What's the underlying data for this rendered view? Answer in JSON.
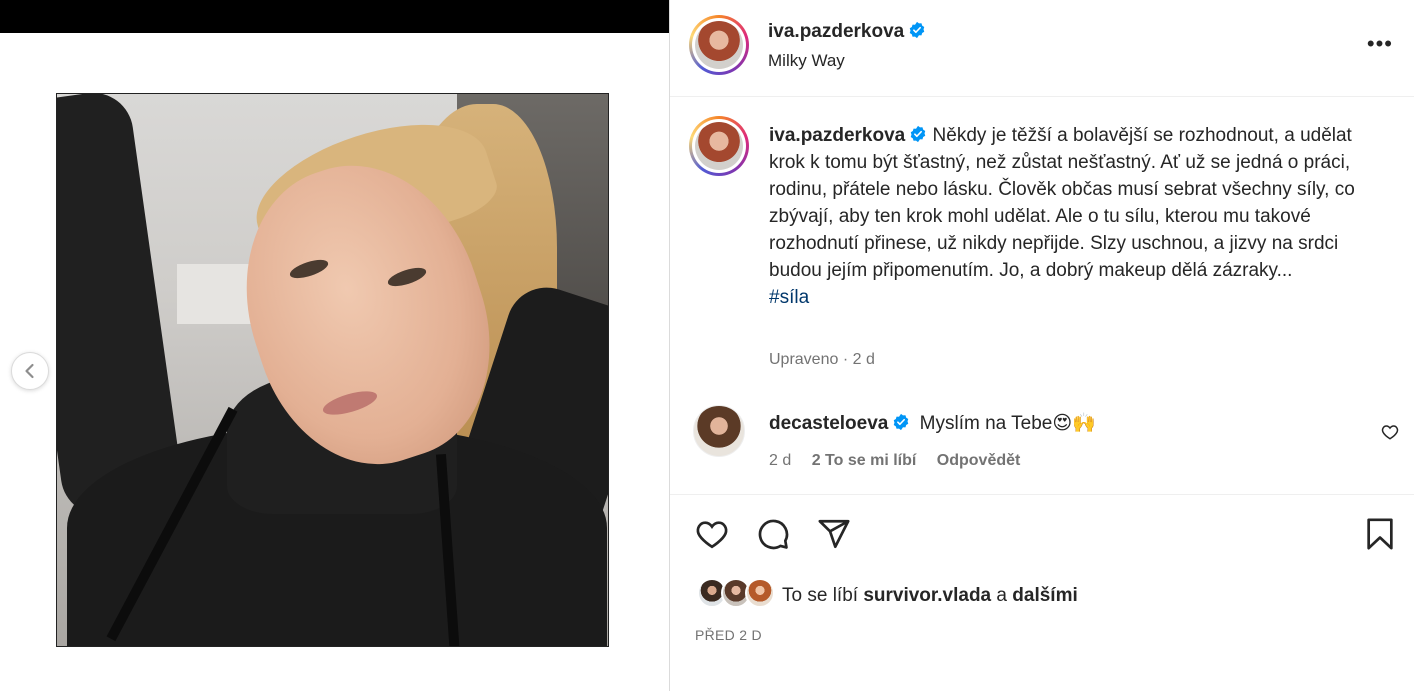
{
  "header": {
    "username": "iva.pazderkova",
    "location": "Milky Way",
    "more_label": "•••"
  },
  "caption": {
    "username": "iva.pazderkova",
    "text": "Někdy je těžší a bolavější se rozhodnout, a udělat krok k tomu být šťastný, než zůstat nešťastný. Ať už se jedná o práci, rodinu, přátele nebo lásku. Člověk občas musí sebrat všechny síly, co zbývají, aby ten krok mohl udělat. Ale o tu sílu, kterou mu takové rozhodnutí přinese, už nikdy nepřijde. Slzy uschnou, a jizvy na srdci budou jejím připomenutím. Jo, a dobrý makeup dělá zázraky...",
    "hashtag": "#síla",
    "edited": "Upraveno · 2 d"
  },
  "comment": {
    "username": "decasteloeva",
    "text": "Myslím na Tebe",
    "emojis": "😍🙌",
    "time": "2 d",
    "likes": "2 To se mi líbí",
    "reply": "Odpovědět"
  },
  "likes": {
    "prefix": "To se líbí",
    "user": "survivor.vlada",
    "conjunction": "a",
    "others": "dalšími"
  },
  "date": "PŘED 2 D",
  "colors": {
    "verified": "#0095f6",
    "hashtag": "#00376b",
    "muted": "#737373",
    "text": "#262626"
  },
  "icons": [
    "verified-badge-icon",
    "heart-icon",
    "comment-icon",
    "share-icon",
    "bookmark-icon",
    "chevron-left-icon",
    "more-icon"
  ]
}
